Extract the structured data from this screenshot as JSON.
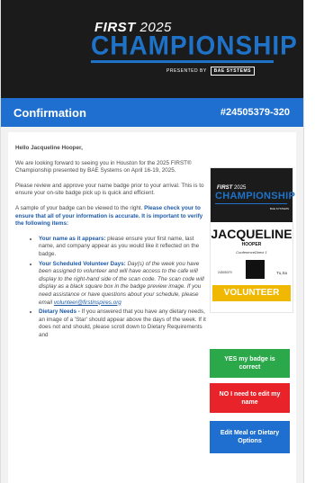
{
  "header": {
    "brand_first": "FIRST",
    "brand_year": "2025",
    "brand_event": "CHAMPIONSHIP",
    "presented_by": "PRESENTED BY",
    "sponsor": "BAE SYSTEMS"
  },
  "bar": {
    "title": "Confirmation",
    "confirmation_number": "#24505379-320"
  },
  "content": {
    "greeting": "Hello Jacqueline Hooper,",
    "p1": "We are looking forward to seeing you in Houston for the 2025 FIRST® Championship presented by BAE Systems on April 16-19, 2025.",
    "p2": "Please review and approve your name badge prior to your arrival. This is to ensure your on-site badge pick up is quick and efficient.",
    "p3_plain": "A sample of your badge can be viewed to the right.",
    "p3_bold": "Please check your to ensure that all of your information is accurate. It is important to verify the following items:",
    "items": [
      {
        "label": "Your name as it appears:",
        "text": "please ensure your first name, last name, and company appear as you would like it reflected on the badge."
      },
      {
        "label": "Your Scheduled Volunteer Days:",
        "text": "Day(s) of the week you have been assigned to volunteer and will have access to the cafe will display to the right-hand side of the scan code. The scan code will display as a black square box in the badge preview image. If you need assistance or have questions about your schedule, please email",
        "email": "volunteer@firstinspires.org"
      },
      {
        "label": "Dietary Needs -",
        "text": "If you answered that you have any dietary needs, an image of a 'Star' should appear above the days of the week. If it does not and should, please scroll down to Dietary Requirements and"
      }
    ]
  },
  "badge": {
    "first": "FIRST",
    "year": "2025",
    "event": "CHAMPIONSHIP",
    "sponsor": "BAE SYSTEMS",
    "name": "JACQUELINE",
    "company": "HOOPER",
    "conference": "ConferenceDirect 1",
    "id": "24505379",
    "days": "Tu,Sa",
    "role": "VOLUNTEER"
  },
  "actions": {
    "correct": "YES my badge is correct",
    "edit": "NO I need to edit my name",
    "meal": "Edit Meal or Dietary Options"
  }
}
